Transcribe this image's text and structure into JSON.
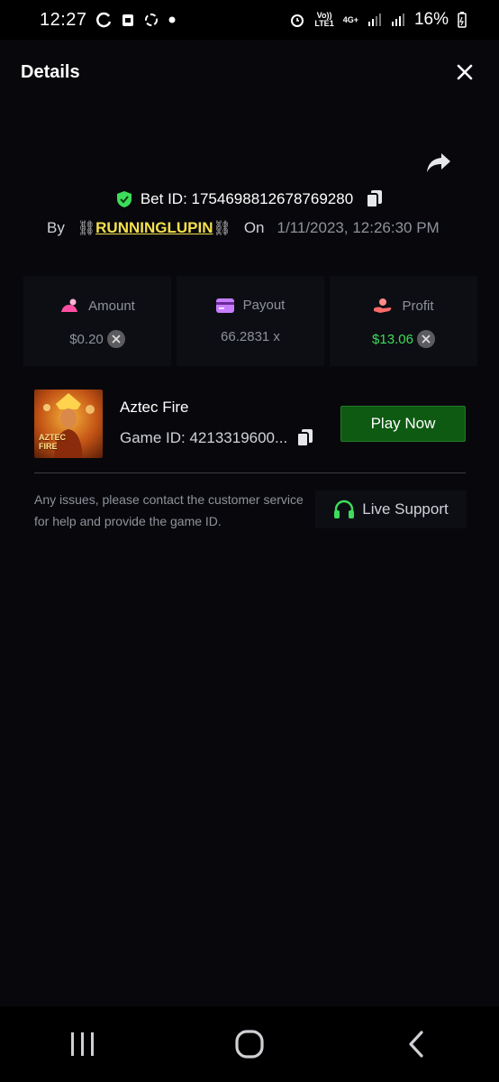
{
  "status_bar": {
    "time": "12:27",
    "left_icons": [
      "refresh-icon",
      "clipboard-icon",
      "sync-icon",
      "dot-icon"
    ],
    "network_top": "Vo))",
    "network_bottom": "LTE1",
    "network_type": "4G+",
    "battery": "16%"
  },
  "header": {
    "title": "Details"
  },
  "bet": {
    "label": "Bet ID: ",
    "id": "1754698812678769280",
    "by_label": "By",
    "user": "RUNNINGLUPIN",
    "chain_glyph": "⛓",
    "on_label": "On",
    "date": "1/11/2023, 12:26:30 PM"
  },
  "stats": [
    {
      "label": "Amount",
      "value": "$0.20",
      "icon": "bet-amount-icon",
      "icon_color": "#ff4fa3"
    },
    {
      "label": "Payout",
      "value": "66.2831 x",
      "icon": "card-icon",
      "icon_color": "#c77dff"
    },
    {
      "label": "Profit",
      "value": "$13.06",
      "icon": "hand-coin-icon",
      "icon_color": "#ff6b6b"
    }
  ],
  "game": {
    "name": "Aztec Fire",
    "id_text": "Game ID: 4213319600...",
    "thumb_line1": "AZTEC",
    "thumb_line2": "FIRE",
    "play_label": "Play Now"
  },
  "support": {
    "help_text": "Any issues, please contact the customer service for help and provide the game ID.",
    "button_label": "Live Support"
  },
  "colors": {
    "accent_green": "#3ddc5a",
    "play_button": "#0e5a12",
    "username": "#f4e04d"
  }
}
